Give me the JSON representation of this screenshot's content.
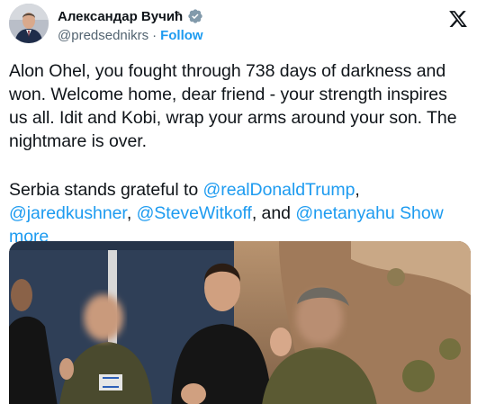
{
  "author": {
    "display_name": "Александар Вучић",
    "handle": "@predsednikrs",
    "separator": "·",
    "follow_label": "Follow",
    "verified_color": "#829aab"
  },
  "tweet": {
    "paragraph1": "Alon Ohel, you fought through 738 days of darkness and won. Welcome home, dear friend - your strength inspires us all. Idit and Kobi, wrap your arms around your son. The nightmare is over.",
    "paragraph2_prefix": "Serbia stands grateful to ",
    "mention_trump": "@realDonaldTrump",
    "sep1": ", ",
    "mention_kushner": "@jaredkushner",
    "sep2": ", ",
    "mention_witkoff": "@SteveWitkoff",
    "sep3": ", and ",
    "mention_netanyahu": "@netanyahu",
    "show_more_label": "Show more"
  },
  "media": {
    "description_icon": "photo",
    "link_color": "#1d9bf0"
  },
  "icons": {
    "platform": "x-logo-icon",
    "verified": "verified-badge-icon"
  }
}
